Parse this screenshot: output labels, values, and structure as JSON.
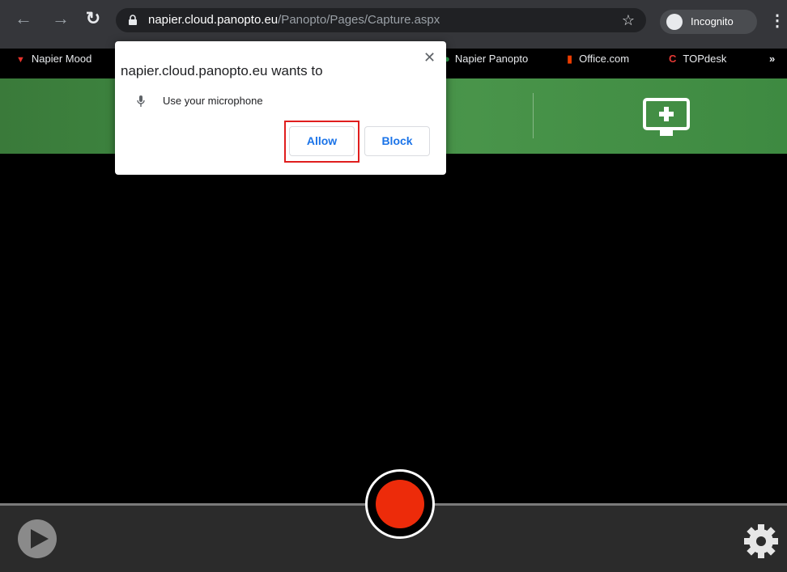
{
  "browser": {
    "url_domain": "napier.cloud.panopto.eu",
    "url_path": "/Panopto/Pages/Capture.aspx",
    "incognito_label": "Incognito",
    "bookmarks": [
      {
        "label": "Napier Mood"
      },
      {
        "label": "Napier Panopto"
      },
      {
        "label": "Office.com"
      },
      {
        "label": "TOPdesk"
      }
    ],
    "overflow": "»"
  },
  "popup": {
    "title": "napier.cloud.panopto.eu wants to",
    "request": "Use your microphone",
    "allow_label": "Allow",
    "block_label": "Block",
    "close_glyph": "✕"
  },
  "colors": {
    "record": "#ed2b0a",
    "header_green": "#3f8a42",
    "highlight": "#e01e1e"
  }
}
